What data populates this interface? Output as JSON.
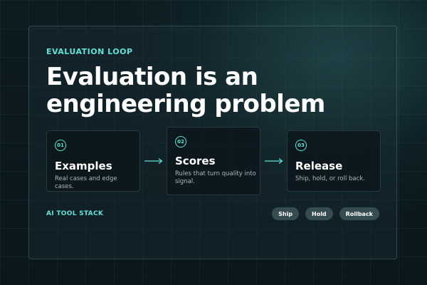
{
  "eyebrow": "EVALUATION LOOP",
  "title": "Evaluation is an engineering problem",
  "steps": [
    {
      "number": "01",
      "title": "Examples",
      "description": "Real cases and edge cases."
    },
    {
      "number": "02",
      "title": "Scores",
      "description": "Rules that turn quality into signal."
    },
    {
      "number": "03",
      "title": "Release",
      "description": "Ship, hold, or roll back."
    }
  ],
  "stack_label": "AI TOOL STACK",
  "actions": [
    "Ship",
    "Hold",
    "Rollback"
  ],
  "colors": {
    "accent": "#5fe3d7",
    "background": "#0a171b",
    "text": "#ffffff",
    "muted": "#a9b9bc"
  }
}
